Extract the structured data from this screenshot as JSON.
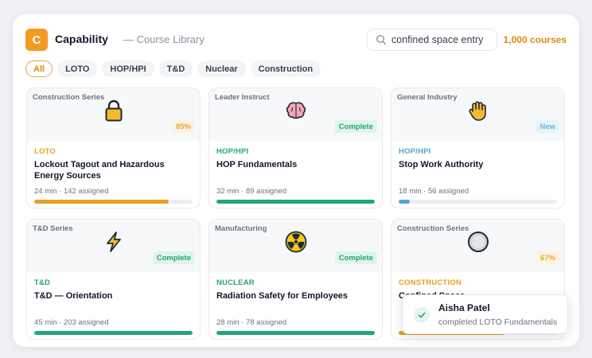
{
  "app": {
    "logo_letter": "C",
    "title": "Capability",
    "subtitle": "— Course Library"
  },
  "search": {
    "value": "confined space entry",
    "placeholder": ""
  },
  "course_count": "1,000 courses",
  "tabs": [
    "All",
    "LOTO",
    "HOP/HPI",
    "T&D",
    "Nuclear",
    "Construction"
  ],
  "active_tab": "All",
  "colors": {
    "accent": "#f29a22",
    "loto": "#e8a01f",
    "hop": "#26a37a",
    "general": "#4aa8d8",
    "td": "#26a37a",
    "nuclear": "#26a37a",
    "construction": "#e8a01f"
  },
  "courses": [
    {
      "series": "Construction Series",
      "icon": "lock-icon",
      "badge": "85%",
      "badge_type": "pct",
      "category": "LOTO",
      "title": "Lockout Tagout and Hazardous Energy Sources",
      "meta": "24 min · 142 assigned",
      "progress": 0.85,
      "color": "#e8a01f"
    },
    {
      "series": "Leader Instruct",
      "icon": "brain-icon",
      "badge": "Complete",
      "badge_type": "complete",
      "category": "HOP/HPI",
      "title": "HOP Fundamentals",
      "meta": "32 min · 89 assigned",
      "progress": 1.0,
      "color": "#26a37a"
    },
    {
      "series": "General Industry",
      "icon": "raised-hand-icon",
      "badge": "New",
      "badge_type": "new",
      "category": "HOP/HPI",
      "title": "Stop Work Authority",
      "meta": "18 min · 56 assigned",
      "progress": 0.07,
      "color": "#4aa8d8"
    },
    {
      "series": "T&D Series",
      "icon": "lightning-icon",
      "badge": "Complete",
      "badge_type": "complete",
      "category": "T&D",
      "title": "T&D — Orientation",
      "meta": "45 min · 203 assigned",
      "progress": 1.0,
      "color": "#26a37a"
    },
    {
      "series": "Manufacturing",
      "icon": "radiation-icon",
      "badge": "Complete",
      "badge_type": "complete",
      "category": "NUCLEAR",
      "title": "Radiation Safety for Employees",
      "meta": "28 min · 78 assigned",
      "progress": 1.0,
      "color": "#26a37a"
    },
    {
      "series": "Construction Series",
      "icon": "hard-hat-icon",
      "badge": "67%",
      "badge_type": "pct",
      "category": "CONSTRUCTION",
      "title": "Confined Space",
      "meta": "",
      "progress": 0.67,
      "color": "#e8a01f"
    }
  ],
  "toast": {
    "name": "Aisha Patel",
    "message": "completed LOTO Fundamentals"
  }
}
